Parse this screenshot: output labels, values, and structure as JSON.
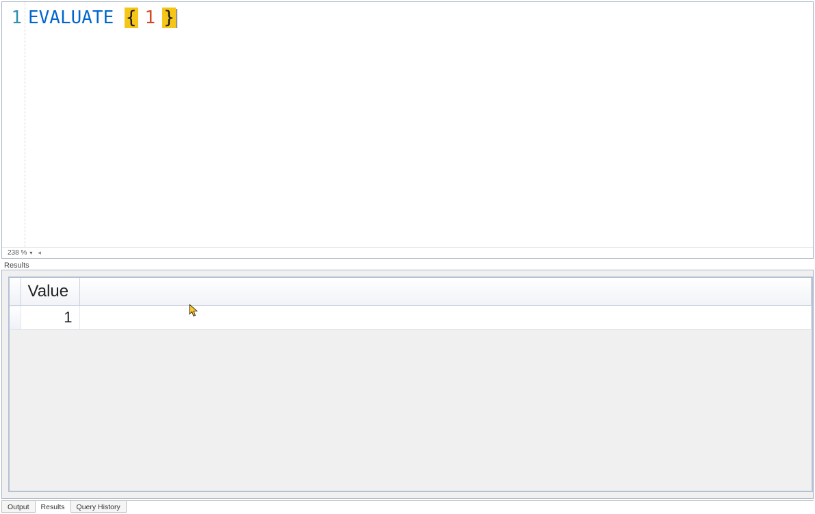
{
  "editor": {
    "line_number": "1",
    "tokens": {
      "keyword": "EVALUATE",
      "brace_open": "{",
      "number": "1",
      "brace_close": "}"
    },
    "zoom_label": "238 %"
  },
  "results": {
    "panel_label": "Results",
    "columns": [
      "Value"
    ],
    "rows": [
      {
        "Value": "1"
      }
    ]
  },
  "tabs": {
    "output": "Output",
    "results": "Results",
    "query_history": "Query History",
    "active": "results"
  }
}
